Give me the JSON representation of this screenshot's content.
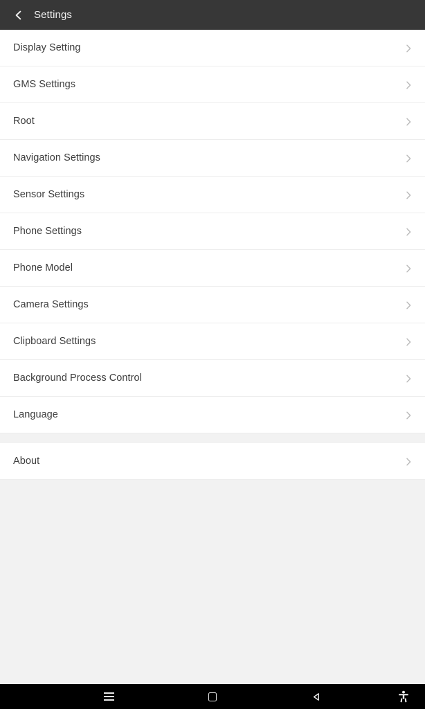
{
  "appbar": {
    "title": "Settings",
    "back_icon": "chevron-left-icon"
  },
  "settings_list": {
    "primary_group": [
      {
        "label": "Display Setting",
        "chevron": "chevron-right-icon"
      },
      {
        "label": "GMS Settings",
        "chevron": "chevron-right-icon"
      },
      {
        "label": "Root",
        "chevron": "chevron-right-icon"
      },
      {
        "label": "Navigation Settings",
        "chevron": "chevron-right-icon"
      },
      {
        "label": "Sensor Settings",
        "chevron": "chevron-right-icon"
      },
      {
        "label": "Phone Settings",
        "chevron": "chevron-right-icon"
      },
      {
        "label": "Phone Model",
        "chevron": "chevron-right-icon"
      },
      {
        "label": "Camera Settings",
        "chevron": "chevron-right-icon"
      },
      {
        "label": "Clipboard Settings",
        "chevron": "chevron-right-icon"
      },
      {
        "label": "Background Process Control",
        "chevron": "chevron-right-icon"
      },
      {
        "label": "Language",
        "chevron": "chevron-right-icon"
      }
    ],
    "secondary_group": [
      {
        "label": "About",
        "chevron": "chevron-right-icon"
      }
    ]
  },
  "navbar": {
    "buttons": [
      {
        "name": "recents-button",
        "icon": "menu-icon"
      },
      {
        "name": "home-button",
        "icon": "home-square-icon"
      },
      {
        "name": "back-button",
        "icon": "back-triangle-icon"
      },
      {
        "name": "accessibility-button",
        "icon": "accessibility-icon"
      }
    ]
  },
  "colors": {
    "appbar_bg": "#373737",
    "appbar_text": "#f1f1f1",
    "page_bg": "#f2f2f2",
    "row_bg": "#ffffff",
    "row_text": "#3d3d3d",
    "divider": "#ededed",
    "chevron": "#b9b9b9",
    "navbar_bg": "#000000",
    "navbar_icon": "#e8e8e8"
  }
}
